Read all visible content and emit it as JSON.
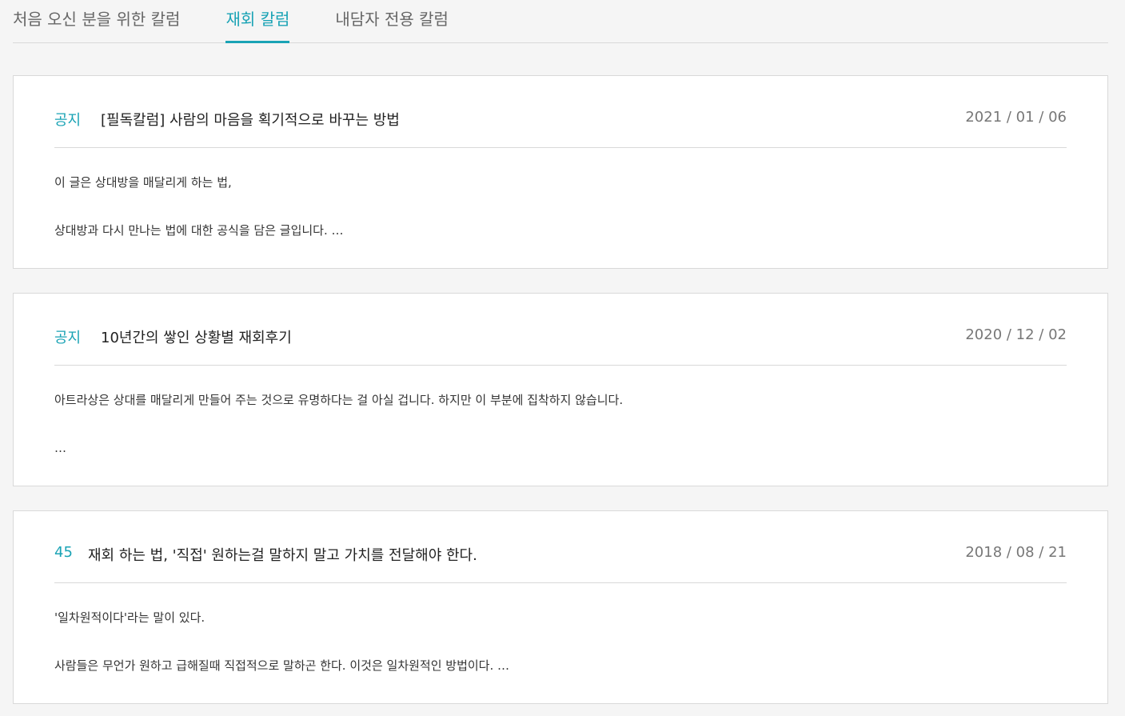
{
  "tabs": [
    {
      "label": "처음 오신 분을 위한 칼럼"
    },
    {
      "label": "재회 칼럼"
    },
    {
      "label": "내담자 전용 칼럼"
    }
  ],
  "posts": [
    {
      "badge": "공지",
      "title": "[필독칼럼] 사람의 마음을 획기적으로 바꾸는 방법",
      "date": "2021 / 01 / 06",
      "excerpt_line1": "이 글은 상대방을 매달리게 하는 법,",
      "excerpt_line2": "상대방과 다시 만나는 법에 대한 공식을 담은 글입니다. …"
    },
    {
      "badge": "공지",
      "title": "10년간의 쌓인 상황별 재회후기",
      "date": "2020 / 12 / 02",
      "excerpt_line1": "아트라상은 상대를 매달리게 만들어 주는 것으로 유명하다는 걸 아실 겁니다. 하지만 이 부분에 집착하지 않습니다.",
      "excerpt_line2": " …"
    },
    {
      "badge": "45",
      "title": "재회 하는 법, '직접' 원하는걸 말하지 말고 가치를 전달해야 한다.",
      "date": "2018 / 08 / 21",
      "excerpt_line1": "'일차원적이다'라는 말이 있다.",
      "excerpt_line2": "사람들은 무언가 원하고 급해질때 직접적으로 말하곤 한다. 이것은 일차원적인 방법이다. …"
    }
  ],
  "colors": {
    "accent": "#1aa3b5",
    "border": "#d9d9d9",
    "background": "#f5f5f5"
  }
}
